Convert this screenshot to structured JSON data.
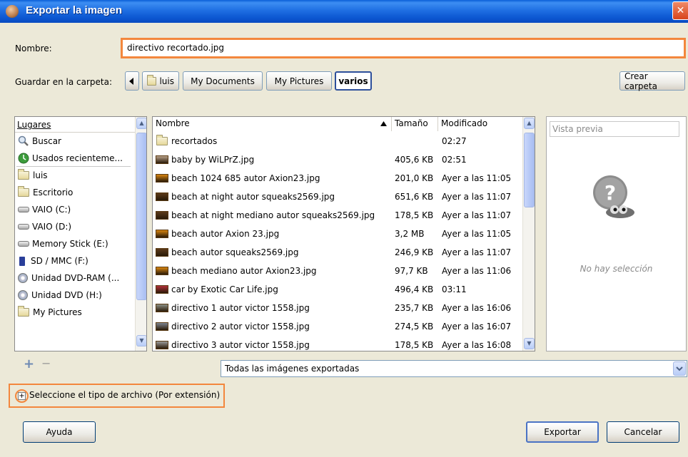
{
  "window": {
    "title": "Exportar la imagen",
    "close_glyph": "✕"
  },
  "form": {
    "name_label": "Nombre:",
    "name_value": "directivo recortado.jpg",
    "folder_label": "Guardar en la carpeta:",
    "path_segments": [
      "luis",
      "My Documents",
      "My Pictures",
      "varios"
    ],
    "create_folder": "Crear carpeta"
  },
  "places": {
    "header": "Lugares",
    "items": [
      {
        "label": "Buscar",
        "icon": "search-icon"
      },
      {
        "label": "Usados recienteme...",
        "icon": "recent-icon"
      },
      {
        "label": "luis",
        "icon": "folder-icon"
      },
      {
        "label": "Escritorio",
        "icon": "folder-icon"
      },
      {
        "label": "VAIO (C:)",
        "icon": "drive-icon"
      },
      {
        "label": "VAIO (D:)",
        "icon": "drive-icon"
      },
      {
        "label": "Memory Stick (E:)",
        "icon": "drive-icon"
      },
      {
        "label": "SD / MMC (F:)",
        "icon": "sd-card-icon"
      },
      {
        "label": "Unidad DVD-RAM (...",
        "icon": "dvd-icon"
      },
      {
        "label": "Unidad DVD (H:)",
        "icon": "dvd-icon"
      },
      {
        "label": "My Pictures",
        "icon": "folder-icon"
      }
    ],
    "add_glyph": "+",
    "remove_glyph": "−"
  },
  "files": {
    "col_name": "Nombre",
    "col_size": "Tamaño",
    "col_modified": "Modificado",
    "rows": [
      {
        "name": "recortados",
        "size": "",
        "modified": "02:27",
        "kind": "folder",
        "color": "#e6d89a"
      },
      {
        "name": "baby by  WiLPrZ.jpg",
        "size": "405,6 KB",
        "modified": "02:51",
        "kind": "image",
        "color": "#b7a189"
      },
      {
        "name": "beach 1024 685 autor Axion23.jpg",
        "size": "201,0 KB",
        "modified": "Ayer a las 11:05",
        "kind": "image",
        "color": "#d8850f"
      },
      {
        "name": "beach at night autor squeaks2569.jpg",
        "size": "651,6 KB",
        "modified": "Ayer a las 11:07",
        "kind": "image",
        "color": "#5c3a1a"
      },
      {
        "name": "beach at night mediano autor squeaks2569.jpg",
        "size": "178,5 KB",
        "modified": "Ayer a las 11:07",
        "kind": "image",
        "color": "#5c3a1a"
      },
      {
        "name": "beach autor Axion 23.jpg",
        "size": "3,2 MB",
        "modified": "Ayer a las 11:05",
        "kind": "image",
        "color": "#d8850f"
      },
      {
        "name": "beach autor squeaks2569.jpg",
        "size": "246,9 KB",
        "modified": "Ayer a las 11:07",
        "kind": "image",
        "color": "#5c3a1a"
      },
      {
        "name": "beach mediano autor Axion23.jpg",
        "size": "97,7 KB",
        "modified": "Ayer a las 11:06",
        "kind": "image",
        "color": "#d8850f"
      },
      {
        "name": "car by Exotic Car Life.jpg",
        "size": "496,4 KB",
        "modified": "03:11",
        "kind": "image",
        "color": "#b0303a"
      },
      {
        "name": "directivo 1 autor victor 1558.jpg",
        "size": "235,7 KB",
        "modified": "Ayer a las 16:06",
        "kind": "image",
        "color": "#8b8f85"
      },
      {
        "name": "directivo 2 autor victor 1558.jpg",
        "size": "274,5 KB",
        "modified": "Ayer a las 16:07",
        "kind": "image",
        "color": "#7d8591"
      },
      {
        "name": "directivo 3 autor victor 1558.jpg",
        "size": "178,5 KB",
        "modified": "Ayer a las 16:08",
        "kind": "image",
        "color": "#9a9a9a"
      }
    ]
  },
  "preview": {
    "header": "Vista previa",
    "empty_text": "No hay selección"
  },
  "filter": {
    "selected": "Todas las imágenes exportadas"
  },
  "filetype": {
    "toggle_glyph": "+",
    "label": "Seleccione el tipo de archivo (Por extensión)"
  },
  "buttons": {
    "help": "Ayuda",
    "export": "Exportar",
    "cancel": "Cancelar"
  },
  "colors": {
    "highlight": "#f3873d",
    "titlebar": "#0b55d0"
  }
}
